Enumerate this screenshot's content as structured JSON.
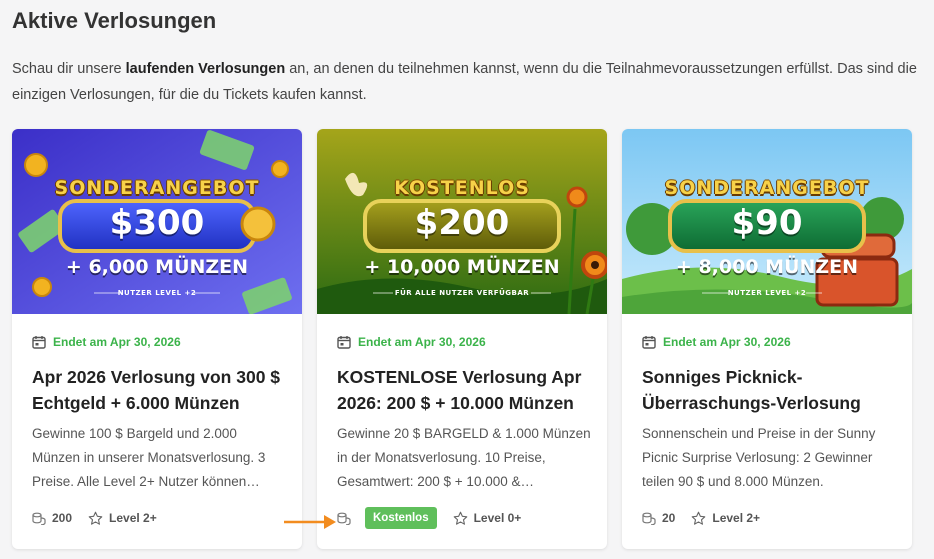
{
  "page": {
    "title": "Aktive Verlosungen",
    "intro_part1": "Schau dir unsere ",
    "intro_bold": "laufenden Verlosungen",
    "intro_part2": " an, an denen du teilnehmen kannst, wenn du die Teilnahmevoraussetzungen erfüllst. Das sind die einzigen Verlosungen, für die du Tickets kaufen kannst."
  },
  "cards": [
    {
      "banner": {
        "headline": "SONDERANGEBOT",
        "amount": "$300",
        "sub": "+ 6,000 MÜNZEN",
        "foot": "NUTZER LEVEL +2",
        "bg_from": "#3b2fc8",
        "bg_to": "#6e6ff0",
        "pill": "#2d3de0"
      },
      "date": "Endet am Apr 30, 2026",
      "title": "Apr 2026 Verlosung von 300 $ Echtgeld + 6.000 Münzen",
      "description": "Gewinne 100 $ Bargeld und 2.000 Münzen in unserer Monatsverlosung. 3 Preise. Alle Level 2+ Nutzer können…",
      "tickets": "200",
      "level": "Level 2+"
    },
    {
      "banner": {
        "headline": "KOSTENLOS",
        "amount": "$200",
        "sub": "+ 10,000 MÜNZEN",
        "foot": "FÜR ALLE NUTZER VERFÜGBAR",
        "bg_from": "#9a9a14",
        "bg_to": "#2f6a10",
        "pill": "#7e7a10"
      },
      "date": "Endet am Apr 30, 2026",
      "title": "KOSTENLOSE Verlosung Apr 2026: 200 $ + 10.000 Münzen",
      "description": "Gewinne 20 $ BARGELD & 1.000 Münzen in der Monatsverlosung. 10 Preise, Gesamtwert: 200 $ + 10.000 &…",
      "badge": "Kostenlos",
      "level": "Level 0+"
    },
    {
      "banner": {
        "headline": "SONDERANGEBOT",
        "amount": "$90",
        "sub": "+ 8,000 MÜNZEN",
        "foot": "NUTZER LEVEL +2",
        "bg_from": "#7dc6f2",
        "bg_to": "#bfe6fb",
        "pill": "#1a8a4a"
      },
      "date": "Endet am Apr 30, 2026",
      "title": "Sonniges Picknick-Überraschungs-Verlosung",
      "description": "Sonnenschein und Preise in der Sunny Picnic Surprise Verlosung: 2 Gewinner teilen 90 $ und 8.000 Münzen.",
      "tickets": "20",
      "level": "Level 2+"
    }
  ],
  "colors": {
    "accent_green": "#3bb34a",
    "badge_green": "#5fbf5b",
    "arrow": "#f28c1f"
  }
}
